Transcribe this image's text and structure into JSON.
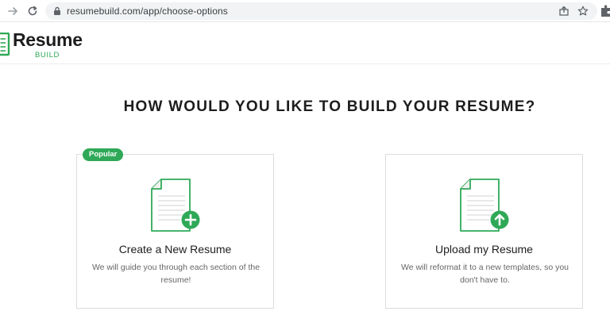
{
  "browser": {
    "url": "resumebuild.com/app/choose-options"
  },
  "header": {
    "logo_word": "Resume",
    "logo_sub": "BUILD"
  },
  "main": {
    "title": "HOW WOULD YOU LIKE TO BUILD YOUR RESUME?",
    "cards": [
      {
        "badge": "Popular",
        "title": "Create a New Resume",
        "description": "We will guide you through each section of the resume!",
        "icon": "document-plus-icon"
      },
      {
        "title": "Upload my Resume",
        "description": "We will reformat it to a new templates, so you don't have to.",
        "icon": "document-upload-icon"
      }
    ]
  },
  "colors": {
    "brand_green": "#2fa957",
    "text_dark": "#1d1d1d",
    "text_muted": "#666666",
    "card_border": "#dcdcdc"
  }
}
